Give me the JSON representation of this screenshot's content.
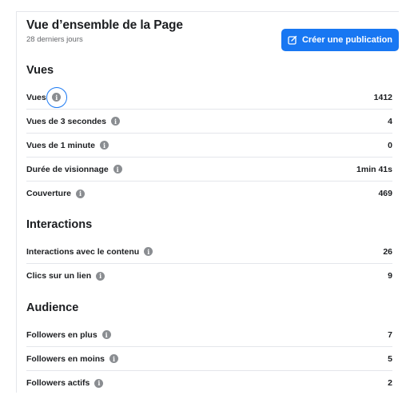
{
  "header": {
    "title": "Vue d’ensemble de la Page",
    "subtitle": "28 derniers jours",
    "create_button": "Créer une publication"
  },
  "sections": {
    "vues": {
      "title": "Vues",
      "rows": [
        {
          "label": "Vues",
          "value": "1412"
        },
        {
          "label": "Vues de 3 secondes",
          "value": "4"
        },
        {
          "label": "Vues de 1 minute",
          "value": "0"
        },
        {
          "label": "Durée de visionnage",
          "value": "1min 41s"
        },
        {
          "label": "Couverture",
          "value": "469"
        }
      ]
    },
    "interactions": {
      "title": "Interactions",
      "rows": [
        {
          "label": "Interactions avec le contenu",
          "value": "26"
        },
        {
          "label": "Clics sur un lien",
          "value": "9"
        }
      ]
    },
    "audience": {
      "title": "Audience",
      "rows": [
        {
          "label": "Followers en plus",
          "value": "7"
        },
        {
          "label": "Followers en moins",
          "value": "5"
        },
        {
          "label": "Followers actifs",
          "value": "2"
        }
      ]
    }
  },
  "icons": {
    "info": "info-icon",
    "edit": "edit-icon"
  },
  "colors": {
    "accent": "#1877f2",
    "info_icon": "#8a8d91",
    "divider": "#e4e6eb"
  }
}
